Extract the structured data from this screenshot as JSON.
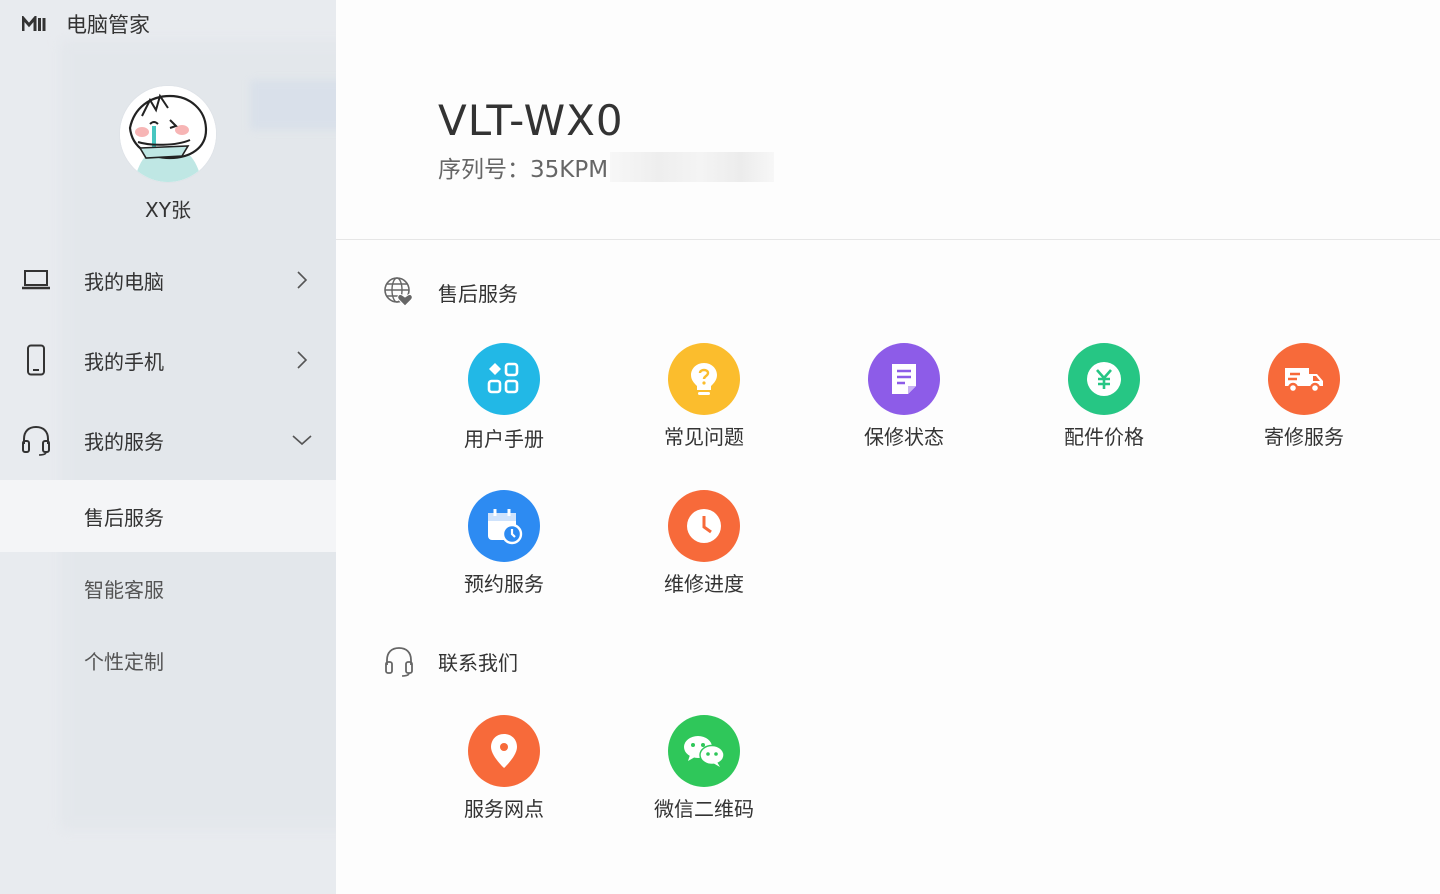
{
  "app": {
    "name": "电脑管家"
  },
  "profile": {
    "username": "XY张"
  },
  "sidebar": {
    "items": [
      {
        "label": "我的电脑",
        "icon": "laptop-icon",
        "expanded": false
      },
      {
        "label": "我的手机",
        "icon": "phone-icon",
        "expanded": false
      },
      {
        "label": "我的服务",
        "icon": "headset-icon",
        "expanded": true
      }
    ],
    "subitems": [
      {
        "label": "售后服务",
        "active": true
      },
      {
        "label": "智能客服",
        "active": false
      },
      {
        "label": "个性定制",
        "active": false
      }
    ]
  },
  "window_controls": [
    "phone-icon",
    "menu-icon",
    "minimize-icon",
    "close-icon"
  ],
  "device": {
    "model": "VLT-WX0",
    "serial_prefix": "序列号：35KPM"
  },
  "sections": {
    "after_sales": {
      "title": "售后服务",
      "icon": "globe-heart-icon",
      "tiles": [
        {
          "label": "用户手册",
          "icon": "apps-grid-icon",
          "color": "#22b8e6"
        },
        {
          "label": "常见问题",
          "icon": "lightbulb-question-icon",
          "color": "#fbbd2d"
        },
        {
          "label": "保修状态",
          "icon": "document-icon",
          "color": "#8d5ce8"
        },
        {
          "label": "配件价格",
          "icon": "yen-icon",
          "color": "#26c684"
        },
        {
          "label": "寄修服务",
          "icon": "truck-icon",
          "color": "#f76a3a"
        },
        {
          "label": "预约服务",
          "icon": "calendar-clock-icon",
          "color": "#2d8bf2"
        },
        {
          "label": "维修进度",
          "icon": "clock-icon",
          "color": "#f76a3a"
        }
      ]
    },
    "contact": {
      "title": "联系我们",
      "icon": "headset-icon",
      "tiles": [
        {
          "label": "服务网点",
          "icon": "location-pin-icon",
          "color": "#f76a3a"
        },
        {
          "label": "微信二维码",
          "icon": "wechat-icon",
          "color": "#2fc75a"
        }
      ]
    }
  }
}
